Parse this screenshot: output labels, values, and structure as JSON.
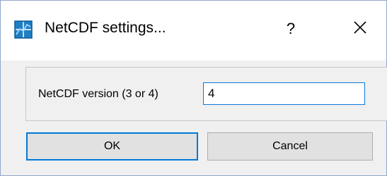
{
  "window": {
    "title": "NetCDF settings...",
    "help_label": "?",
    "close_icon": "close-icon",
    "app_icon": "netcdf-app-icon"
  },
  "form": {
    "version_label": "NetCDF version (3 or 4)",
    "version_value": "4"
  },
  "buttons": {
    "ok_label": "OK",
    "cancel_label": "Cancel"
  },
  "colors": {
    "focus_accent": "#0078d7",
    "dialog_background": "#f0f0f0",
    "titlebar_background": "#ffffff"
  }
}
